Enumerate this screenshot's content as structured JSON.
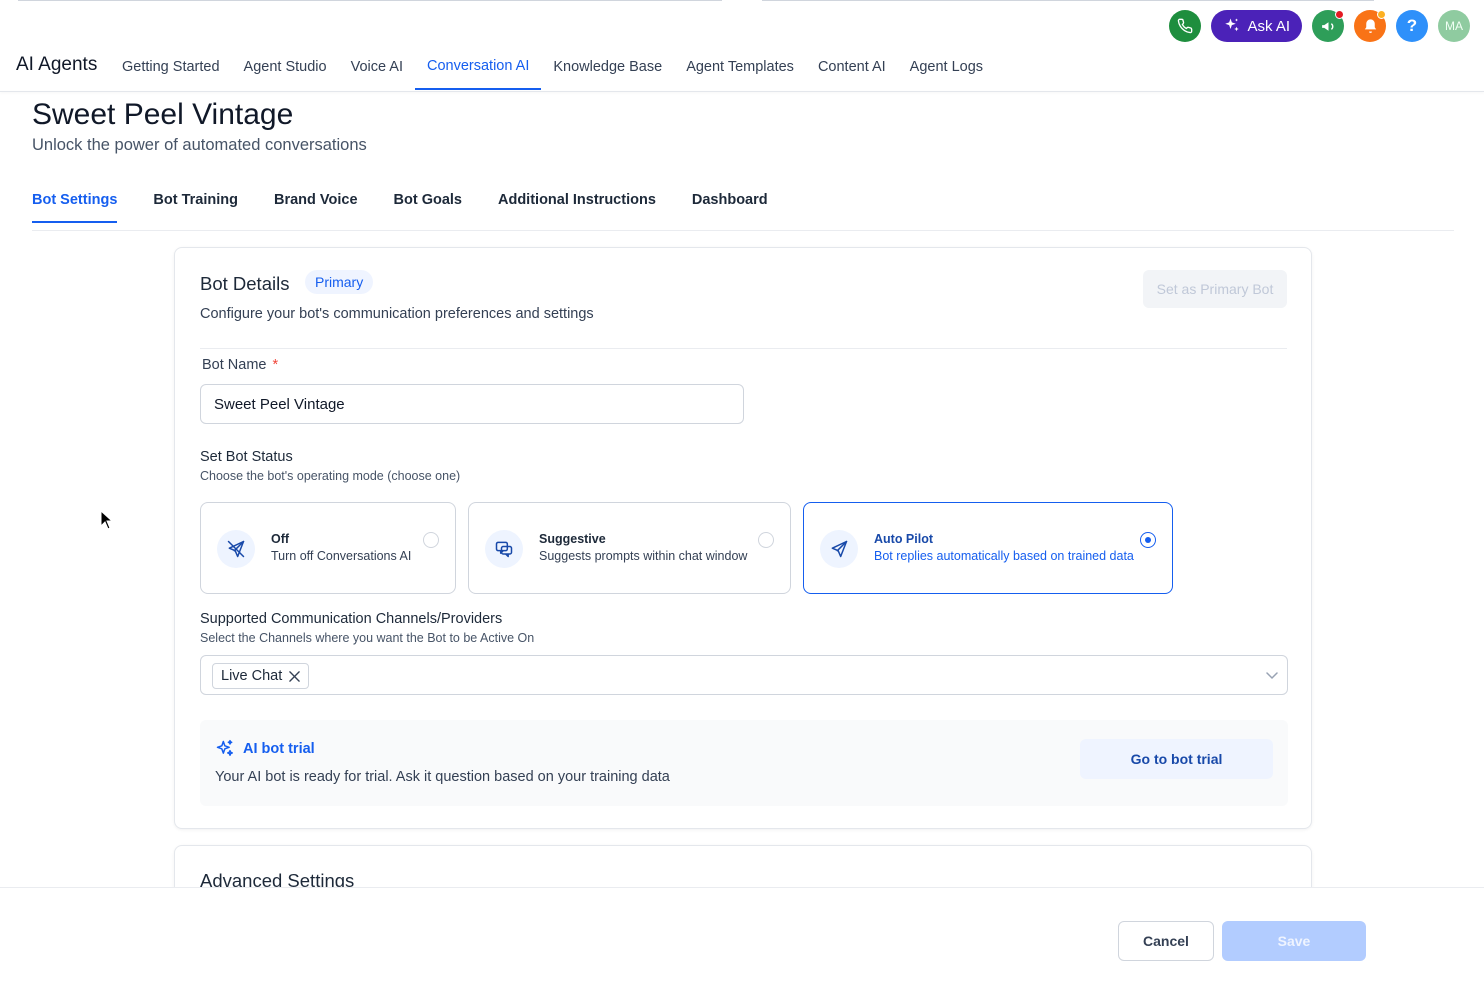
{
  "top_actions": {
    "ask_ai_label": "Ask AI",
    "help_label": "?",
    "avatar_initials": "MA",
    "colors": {
      "phone": "#1e8e3e",
      "ask_ai": "#4b22b8",
      "announce": "#2e9e59",
      "notify": "#f97316",
      "help": "#2e90fa"
    }
  },
  "app": {
    "title": "AI Agents"
  },
  "main_nav": {
    "items": [
      {
        "label": "Getting Started"
      },
      {
        "label": "Agent Studio"
      },
      {
        "label": "Voice AI"
      },
      {
        "label": "Conversation AI",
        "active": true
      },
      {
        "label": "Knowledge Base"
      },
      {
        "label": "Agent Templates"
      },
      {
        "label": "Content AI"
      },
      {
        "label": "Agent Logs"
      }
    ]
  },
  "page": {
    "title": "Sweet Peel Vintage",
    "subtitle": "Unlock the power of automated conversations"
  },
  "sub_tabs": {
    "items": [
      {
        "label": "Bot Settings",
        "active": true
      },
      {
        "label": "Bot Training"
      },
      {
        "label": "Brand Voice"
      },
      {
        "label": "Bot Goals"
      },
      {
        "label": "Additional Instructions"
      },
      {
        "label": "Dashboard"
      }
    ]
  },
  "bot_details": {
    "title": "Bot Details",
    "badge": "Primary",
    "description": "Configure your bot's communication preferences and settings",
    "set_primary_label": "Set as Primary Bot",
    "bot_name_label": "Bot Name",
    "required_mark": "*",
    "bot_name_value": "Sweet Peel Vintage",
    "status_title": "Set Bot Status",
    "status_desc": "Choose the bot's operating mode (choose one)",
    "modes": [
      {
        "title": "Off",
        "subtitle": "Turn off Conversations AI",
        "icon": "bot-off-icon",
        "selected": false
      },
      {
        "title": "Suggestive",
        "subtitle": "Suggests prompts within chat window",
        "icon": "chat-bubbles-icon",
        "selected": false
      },
      {
        "title": "Auto Pilot",
        "subtitle": "Bot replies automatically based on trained data",
        "icon": "send-icon",
        "selected": true
      }
    ],
    "channels_title": "Supported Communication Channels/Providers",
    "channels_desc": "Select the Channels where you want the Bot to be Active On",
    "channels_selected": [
      "Live Chat"
    ],
    "trial": {
      "title": "AI bot trial",
      "description": "Your AI bot is ready for trial. Ask it question based on your training data",
      "button": "Go to bot trial"
    }
  },
  "advanced": {
    "title": "Advanced Settings"
  },
  "footer": {
    "cancel_label": "Cancel",
    "save_label": "Save"
  }
}
